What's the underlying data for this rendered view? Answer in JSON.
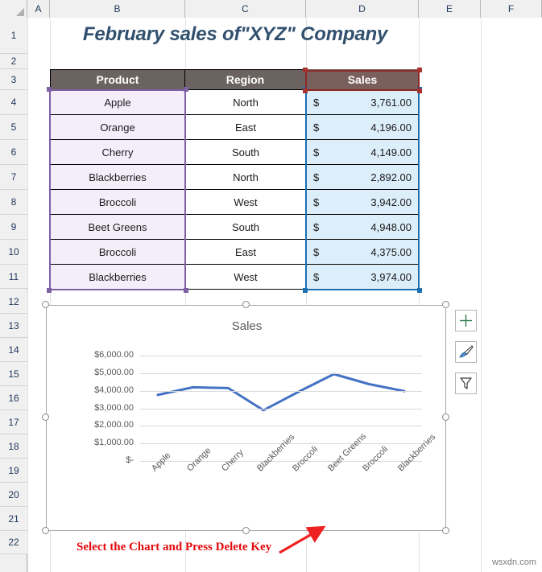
{
  "grid": {
    "columns": [
      "A",
      "B",
      "C",
      "D",
      "E",
      "F"
    ],
    "rows": [
      "1",
      "2",
      "3",
      "4",
      "5",
      "6",
      "7",
      "8",
      "9",
      "10",
      "11",
      "12",
      "13",
      "14",
      "15",
      "16",
      "17",
      "18",
      "19",
      "20",
      "21",
      "22"
    ]
  },
  "worksheet": {
    "title": "February sales of\"XYZ\" Company"
  },
  "table": {
    "headers": [
      "Product",
      "Region",
      "Sales"
    ],
    "rows": [
      {
        "product": "Apple",
        "region": "North",
        "currency": "$",
        "sales": "3,761.00"
      },
      {
        "product": "Orange",
        "region": "East",
        "currency": "$",
        "sales": "4,196.00"
      },
      {
        "product": "Cherry",
        "region": "South",
        "currency": "$",
        "sales": "4,149.00"
      },
      {
        "product": "Blackberries",
        "region": "North",
        "currency": "$",
        "sales": "2,892.00"
      },
      {
        "product": "Broccoli",
        "region": "West",
        "currency": "$",
        "sales": "3,942.00"
      },
      {
        "product": "Beet Greens",
        "region": "South",
        "currency": "$",
        "sales": "4,948.00"
      },
      {
        "product": "Broccoli",
        "region": "East",
        "currency": "$",
        "sales": "4,375.00"
      },
      {
        "product": "Blackberries",
        "region": "West",
        "currency": "$",
        "sales": "3,974.00"
      }
    ]
  },
  "chart_data": {
    "type": "line",
    "title": "Sales",
    "categories": [
      "Apple",
      "Orange",
      "Cherry",
      "Blackberries",
      "Broccoli",
      "Beet Greens",
      "Broccoli",
      "Blackberries"
    ],
    "series": [
      {
        "name": "Sales",
        "values": [
          3761,
          4196,
          4149,
          2892,
          3942,
          4948,
          4375,
          3974
        ],
        "color": "#4472c4"
      }
    ],
    "ylabel": "",
    "xlabel": "",
    "ylim": [
      0,
      6000
    ],
    "ytick_labels": [
      "$6,000.00",
      "$5,000.00",
      "$4,000.00",
      "$3,000.00",
      "$2,000.00",
      "$1,000.00",
      "$-"
    ],
    "ytick_values": [
      6000,
      5000,
      4000,
      3000,
      2000,
      1000,
      0
    ],
    "grid": true,
    "legend": "none"
  },
  "chart_buttons": [
    {
      "name": "chart-elements",
      "icon": "plus-icon"
    },
    {
      "name": "chart-styles",
      "icon": "paintbrush-icon"
    },
    {
      "name": "chart-filters",
      "icon": "funnel-icon"
    }
  ],
  "annotation": {
    "text": "Select the Chart and Press Delete Key",
    "color": "#e3080c"
  },
  "watermark": {
    "text": "wsxdn.com"
  },
  "colors": {
    "header_fill": "#6b6360",
    "sales_header_fill": "#7a605d",
    "product_fill": "#f3eefa",
    "sales_fill": "#ddeefb",
    "selection_purple": "#7f5fa5",
    "selection_blue": "#1d70b0",
    "selection_red": "#8c2a28",
    "line_color": "#4472c4",
    "title_color": "#31506e"
  }
}
